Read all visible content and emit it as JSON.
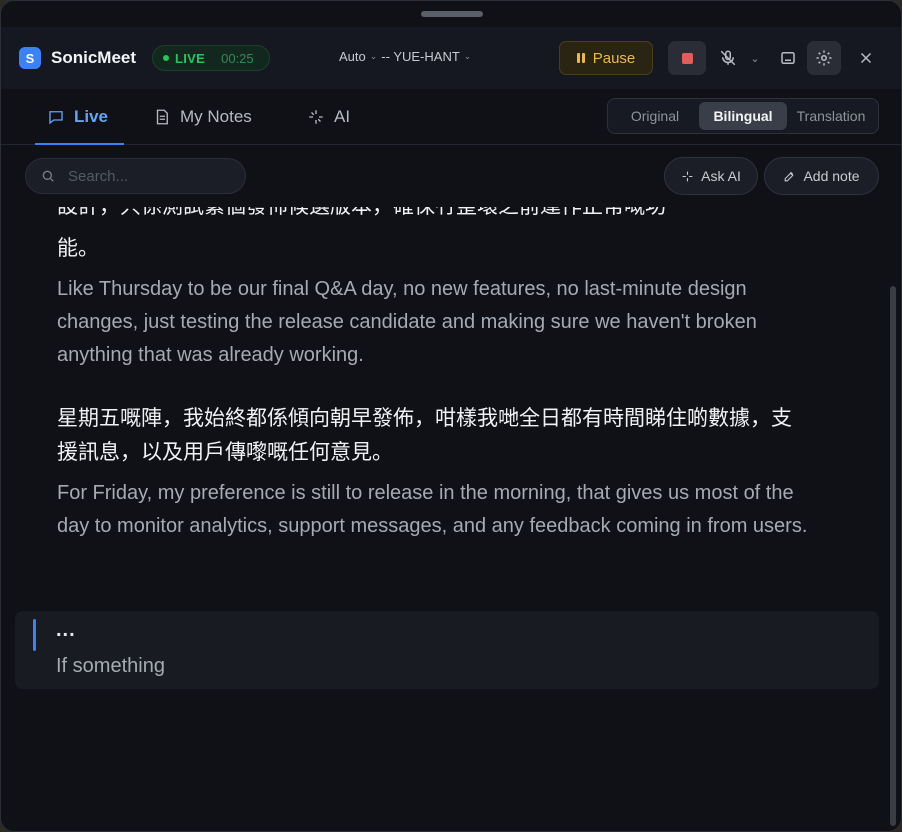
{
  "app": {
    "name": "SonicMeet",
    "logo_letter": "S",
    "live_label": "LIVE",
    "elapsed": "00:25",
    "source_lang": "Auto",
    "target_lang": "-- YUE-HANT",
    "pause_label": "Pause"
  },
  "tabs": [
    {
      "label": "Live",
      "icon": "chat-icon",
      "active": true
    },
    {
      "label": "My Notes",
      "icon": "notes-icon",
      "active": false
    },
    {
      "label": "AI",
      "icon": "sparkle-icon",
      "active": false
    }
  ],
  "view_modes": [
    {
      "label": "Original",
      "active": false
    },
    {
      "label": "Bilingual",
      "active": true
    },
    {
      "label": "Translation",
      "active": false
    }
  ],
  "toolbar": {
    "search_placeholder": "Search...",
    "ask_ai_label": "Ask AI",
    "add_note_label": "Add note"
  },
  "transcript": {
    "partial_top": "設計，只係測試緊個發佈候選版本，確保冇整壞之前運作正常嘅功",
    "segments": [
      {
        "zh_tail": "能。",
        "en": "Like Thursday to be our final Q&A day, no new features, no last-minute design changes, just testing the release candidate and making sure we haven't broken anything that was already working."
      },
      {
        "zh": "星期五嘅陣，我始終都係傾向朝早發佈，咁樣我哋全日都有時間睇住啲數據，支援訊息，以及用戶傳嚟嘅任何意見。",
        "en": "For Friday, my preference is still to release in the morning, that gives us most of the day to monitor analytics, support messages, and any feedback coming in from users."
      }
    ],
    "live": {
      "pending": "...",
      "partial": "If something"
    }
  },
  "colors": {
    "accent": "#3b82f6",
    "live_green": "#22c55e",
    "pause_amber": "#e9b949",
    "stop_red": "#e25c5c"
  }
}
